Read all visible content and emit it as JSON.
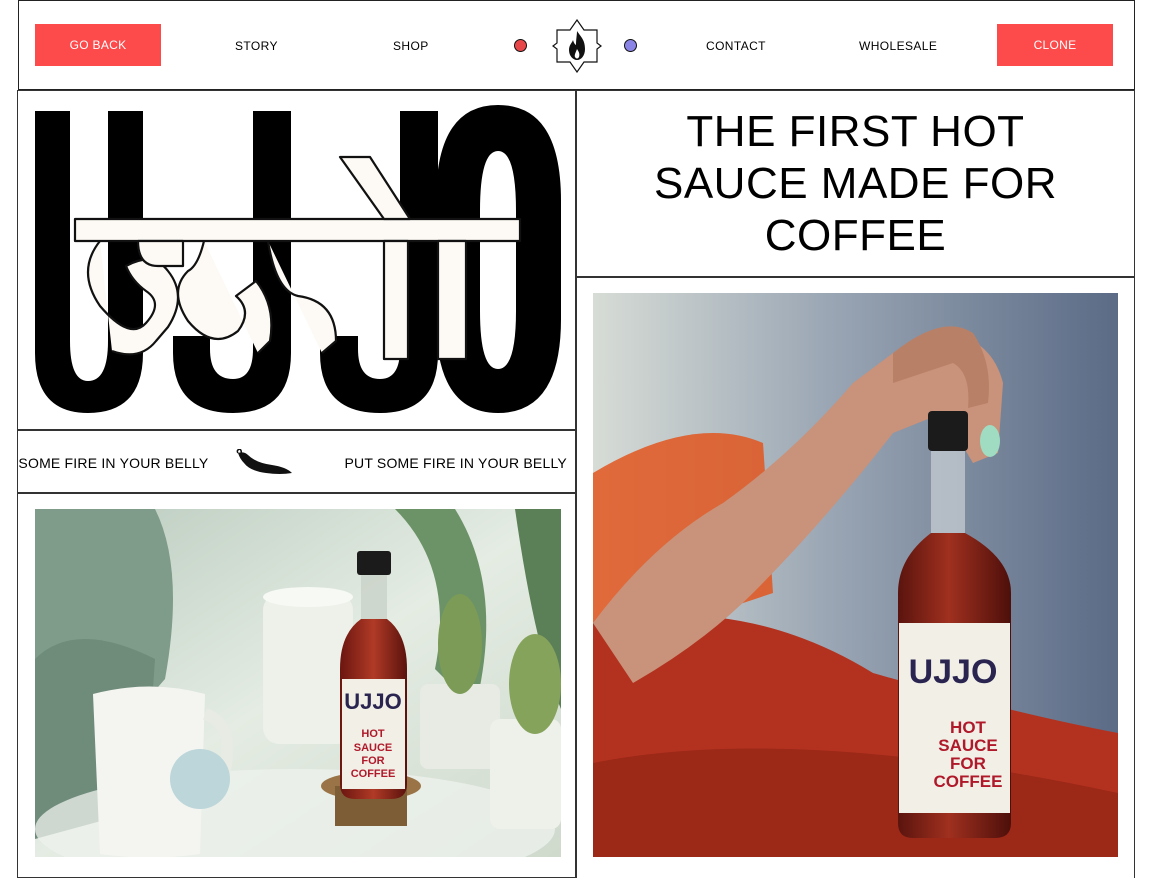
{
  "nav": {
    "go_back": "GO BACK",
    "story": "STORY",
    "shop": "SHOP",
    "contact": "CONTACT",
    "wholesale": "WHOLESALE",
    "clone": "CLONE",
    "accent": "#fd4b4c",
    "dot_left_color": "#e8474a",
    "dot_right_color": "#8a84e6"
  },
  "hero": {
    "latin_wordmark": "UJJO",
    "devanagari_wordmark": "उज्जो"
  },
  "headline": "THE FIRST HOT SAUCE MADE FOR COFFEE",
  "ticker": {
    "text": "PUT SOME FIRE IN YOUR BELLY",
    "icon": "chili-pepper-icon"
  },
  "photos": {
    "left_label": {
      "line1": "HOT",
      "line2": "SAUCE",
      "line3": "FOR",
      "line4": "COFFEE"
    },
    "right_label": {
      "line1": "HOT",
      "line2": "SAUCE",
      "line3": "FOR",
      "line4": "COFFEE"
    },
    "bottle_brand": "UJJO"
  }
}
